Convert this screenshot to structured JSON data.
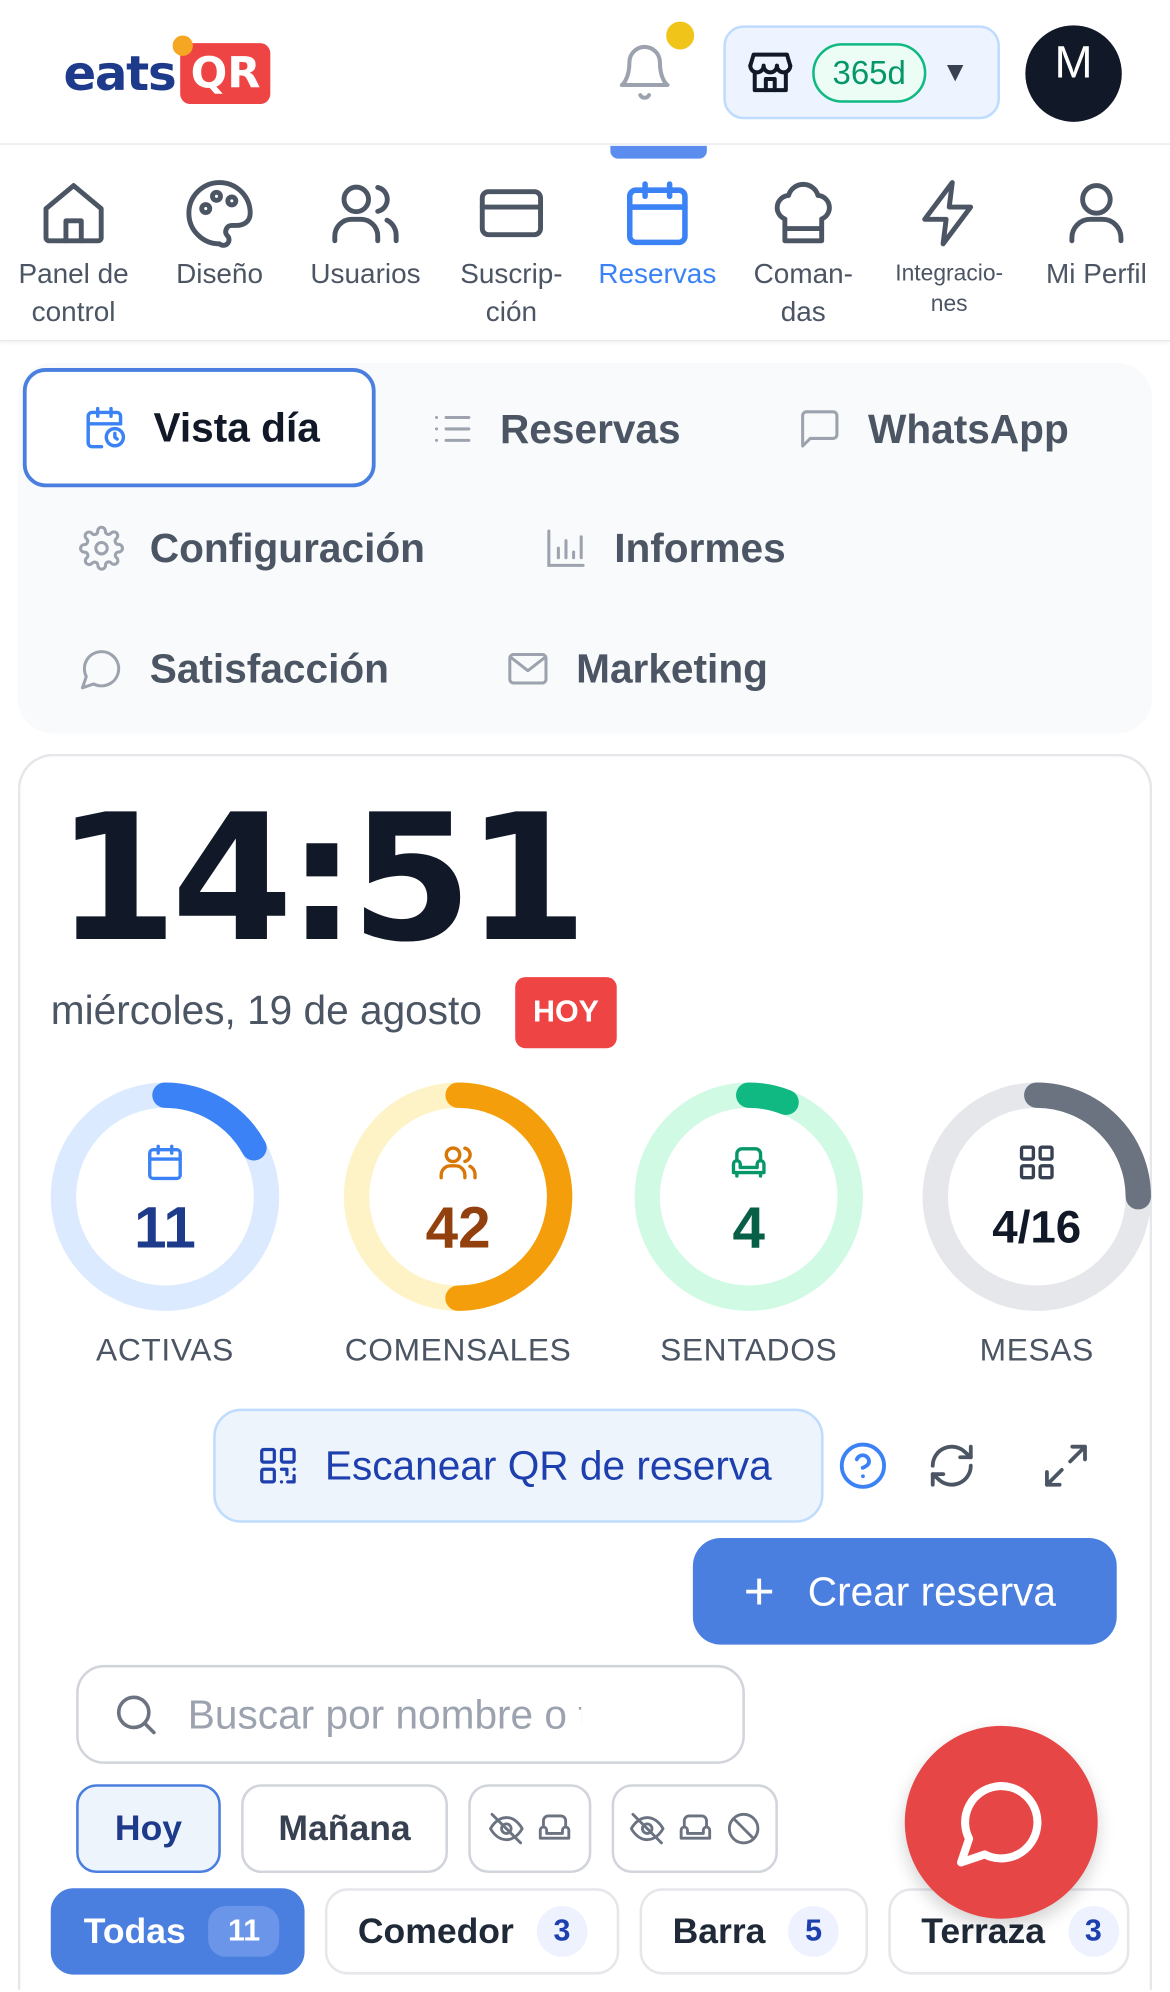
{
  "header": {
    "logo_text": "eats",
    "logo_badge": "QR",
    "subscription_days": "365d",
    "avatar_initial": "M"
  },
  "nav": {
    "items": [
      {
        "label": "Panel de\ncontrol",
        "icon": "home-icon"
      },
      {
        "label": "Diseño",
        "icon": "palette-icon"
      },
      {
        "label": "Usuarios",
        "icon": "users-icon"
      },
      {
        "label": "Suscrip-\nción",
        "icon": "credit-card-icon"
      },
      {
        "label": "Reservas",
        "icon": "calendar-icon",
        "active": true
      },
      {
        "label": "Coman-\ndas",
        "icon": "chef-hat-icon"
      },
      {
        "label": "Integracio-\nnes",
        "icon": "lightning-icon"
      },
      {
        "label": "Mi Perfil",
        "icon": "user-icon"
      }
    ]
  },
  "subtabs": {
    "vista_dia": "Vista día",
    "reservas": "Reservas",
    "whatsapp": "WhatsApp",
    "configuracion": "Configuración",
    "informes": "Informes",
    "satisfaccion": "Satisfacción",
    "marketing": "Marketing"
  },
  "clock": {
    "time": "14:51",
    "date": "miércoles, 19 de agosto",
    "today_badge": "HOY"
  },
  "stats": [
    {
      "value": "11",
      "label": "ACTIVAS",
      "fraction": 0.17,
      "color": "#3b82f6",
      "track": "#dbeafe",
      "value_color": "#1e3a8a"
    },
    {
      "value": "42",
      "label": "COMENSALES",
      "fraction": 0.5,
      "color": "#f59e0b",
      "track": "#fef3c7",
      "value_color": "#92400e"
    },
    {
      "value": "4",
      "label": "SENTADOS",
      "fraction": 0.06,
      "color": "#10b981",
      "track": "#d1fae5",
      "value_color": "#065f46"
    },
    {
      "value": "4/16",
      "label": "MESAS",
      "fraction": 0.25,
      "color": "#6b7280",
      "track": "#e5e7eb",
      "value_color": "#111827"
    }
  ],
  "actions": {
    "scan_label": "Escanear QR de reserva",
    "create_label": "Crear reserva"
  },
  "search": {
    "placeholder": "Buscar por nombre o teléfono"
  },
  "day_filters": {
    "today": "Hoy",
    "tomorrow": "Mañana"
  },
  "zones": [
    {
      "label": "Todas",
      "count": "11",
      "active": true
    },
    {
      "label": "Comedor",
      "count": "3"
    },
    {
      "label": "Barra",
      "count": "5"
    },
    {
      "label": "Terraza",
      "count": "3"
    }
  ],
  "colors": {
    "accent": "#4a7fe0",
    "brand_red": "#ef4444"
  }
}
